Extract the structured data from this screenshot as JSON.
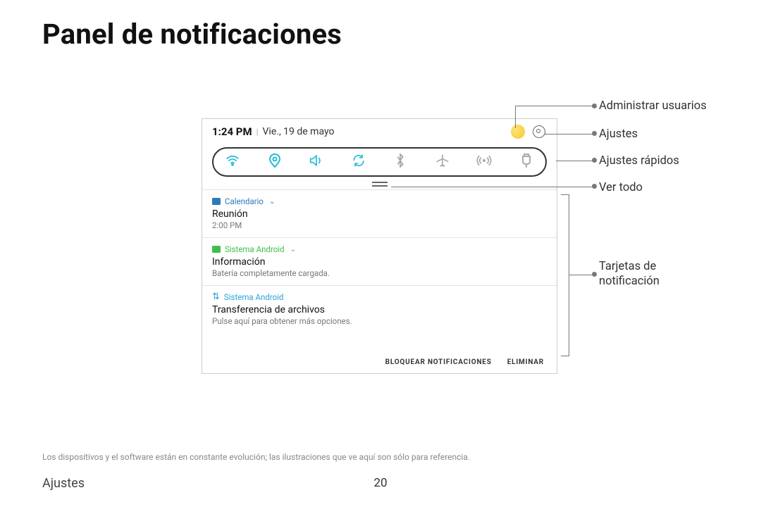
{
  "page": {
    "title": "Panel de notificaciones",
    "footnote": "Los dispositivos y el software están en constante evolución; las ilustraciones que ve aquí son sólo para referencia.",
    "footerLeft": "Ajustes",
    "pageNumber": "20"
  },
  "header": {
    "time": "1:24 PM",
    "date": "Vie., 19 de mayo"
  },
  "quickSettings": {
    "icons": [
      "wifi",
      "location",
      "sound",
      "sync",
      "bluetooth",
      "airplane",
      "hotspot",
      "power-share"
    ]
  },
  "notifications": {
    "cal": {
      "app": "Calendario",
      "title": "Reunión",
      "sub": "2:00 PM",
      "iconColor": "#2a7bbb"
    },
    "sys1": {
      "app": "Sistema Android",
      "title": "Información",
      "sub": "Batería completamente cargada.",
      "iconColor": "#3fbf4a"
    },
    "sys2": {
      "app": "Sistema Android",
      "title": "Transferencia de archivos",
      "sub": "Pulse aquí para obtener más opciones."
    }
  },
  "footerButtons": {
    "block": "BLOQUEAR NOTIFICACIONES",
    "clear": "ELIMINAR"
  },
  "callouts": {
    "users": "Administrar usuarios",
    "settings": "Ajustes",
    "quick": "Ajustes rápidos",
    "seeAll": "Ver todo",
    "cards": "Tarjetas de notificación"
  }
}
